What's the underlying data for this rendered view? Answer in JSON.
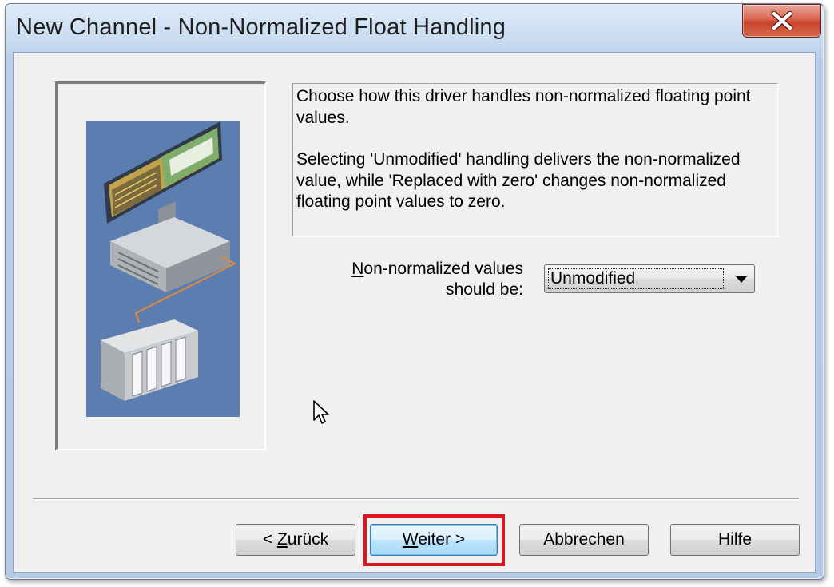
{
  "window": {
    "title": "New Channel - Non-Normalized Float Handling",
    "close_icon": "close-x-icon"
  },
  "description": {
    "paragraph1": "Choose how this driver handles non-normalized floating point values.",
    "paragraph2": "Selecting 'Unmodified' handling delivers the non-normalized value, while 'Replaced with zero' changes non-normalized floating point values to zero."
  },
  "setting": {
    "label_line1_mnemonic": "N",
    "label_line1_rest": "on-normalized values",
    "label_line2": "should be:",
    "selected_value": "Unmodified"
  },
  "buttons": {
    "back_prefix": "< ",
    "back_mnemonic": "Z",
    "back_rest": "urück",
    "next_mnemonic": "W",
    "next_rest": "eiter >",
    "cancel": "Abbrechen",
    "help": "Hilfe"
  },
  "colors": {
    "highlight": "#e0141e",
    "illustration_bg": "#5b7db0",
    "close_button": "#c7432b"
  }
}
